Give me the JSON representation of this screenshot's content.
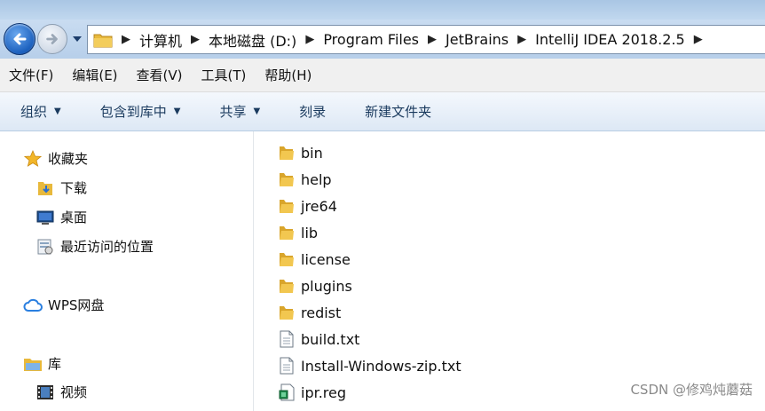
{
  "address": {
    "crumbs": [
      "计算机",
      "本地磁盘 (D:)",
      "Program Files",
      "JetBrains",
      "IntelliJ IDEA 2018.2.5"
    ]
  },
  "menu": [
    "文件(F)",
    "编辑(E)",
    "查看(V)",
    "工具(T)",
    "帮助(H)"
  ],
  "toolbar": [
    {
      "label": "组织",
      "has_caret": true
    },
    {
      "label": "包含到库中",
      "has_caret": true
    },
    {
      "label": "共享",
      "has_caret": true
    },
    {
      "label": "刻录",
      "has_caret": false
    },
    {
      "label": "新建文件夹",
      "has_caret": false
    }
  ],
  "sidebar": {
    "favorites": "收藏夹",
    "downloads": "下载",
    "desktop": "桌面",
    "recent": "最近访问的位置",
    "wps": "WPS网盘",
    "library": "库",
    "videos": "视频"
  },
  "files": [
    {
      "name": "bin",
      "type": "folder"
    },
    {
      "name": "help",
      "type": "folder"
    },
    {
      "name": "jre64",
      "type": "folder"
    },
    {
      "name": "lib",
      "type": "folder"
    },
    {
      "name": "license",
      "type": "folder"
    },
    {
      "name": "plugins",
      "type": "folder"
    },
    {
      "name": "redist",
      "type": "folder"
    },
    {
      "name": "build.txt",
      "type": "text"
    },
    {
      "name": "Install-Windows-zip.txt",
      "type": "text"
    },
    {
      "name": "ipr.reg",
      "type": "registry"
    }
  ],
  "watermark": "CSDN @修鸡炖蘑菇",
  "colors": {
    "folder": "#e8b93c",
    "accent": "#1a5fbd"
  }
}
